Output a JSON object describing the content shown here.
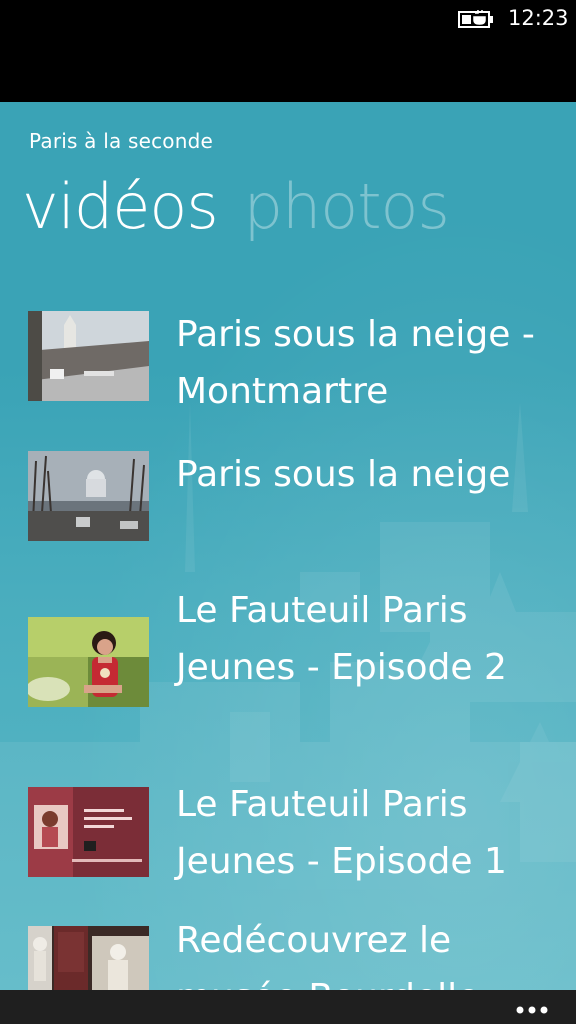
{
  "status_bar": {
    "time": "12:23",
    "battery_icon": "battery-charging-icon"
  },
  "app": {
    "title": "Paris à la seconde"
  },
  "pivot": {
    "tabs": [
      {
        "label": "vidéos",
        "active": true
      },
      {
        "label": "photos",
        "active": false
      }
    ]
  },
  "videos": [
    {
      "title": "Paris sous la neige - Montmartre"
    },
    {
      "title": "Paris sous la neige"
    },
    {
      "title": "Le Fauteuil Paris Jeunes - Episode 2"
    },
    {
      "title": "Le Fauteuil Paris Jeunes - Episode 1"
    },
    {
      "title": "Redécouvrez le musée Bourdelle"
    }
  ],
  "app_bar": {
    "more_icon": "ellipsis-icon"
  },
  "colors": {
    "accent_bg": "#3aa3b6",
    "inactive_tab": "rgba(255,255,255,0.35)"
  }
}
